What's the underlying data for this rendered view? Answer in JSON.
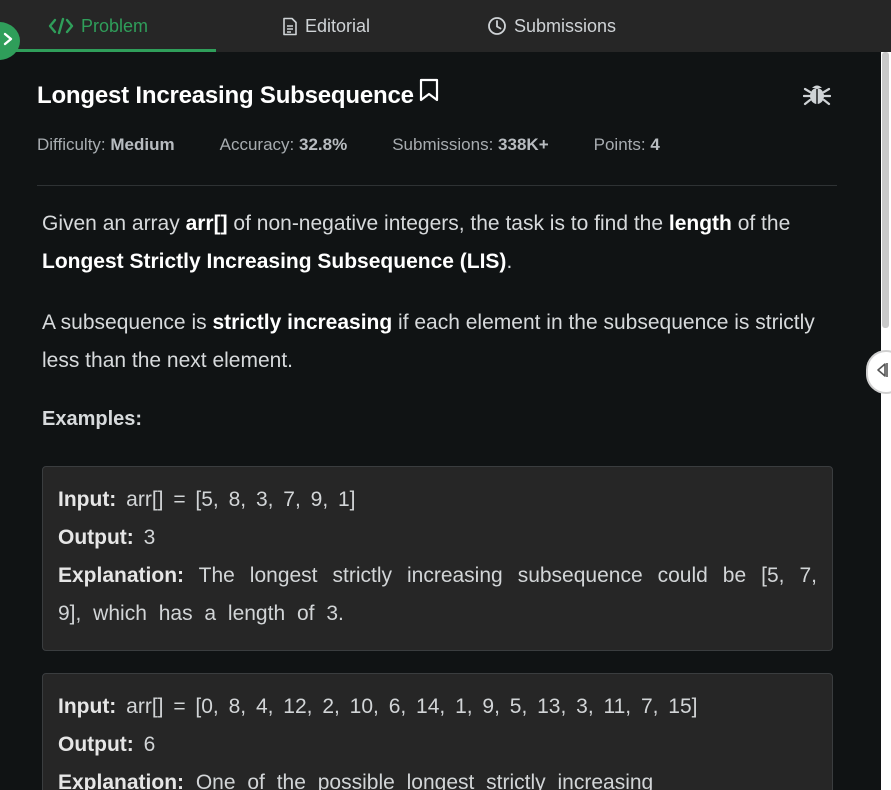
{
  "tabs": {
    "problem": "Problem",
    "editorial": "Editorial",
    "submissions": "Submissions"
  },
  "problem": {
    "title": "Longest Increasing Subsequence",
    "meta": {
      "difficulty_label": "Difficulty:",
      "difficulty": "Medium",
      "accuracy_label": "Accuracy:",
      "accuracy": "32.8%",
      "submissions_label": "Submissions:",
      "submissions": "338K+",
      "points_label": "Points:",
      "points": "4"
    },
    "description": {
      "p1_a": "Given an array ",
      "p1_b": "arr[]",
      "p1_c": " of non-negative integers, the task is to find the ",
      "p1_d": "length",
      "p1_e": " of the ",
      "p1_f": "Longest Strictly Increasing Subsequence (LIS)",
      "p1_g": ".",
      "p2_a": "A subsequence is ",
      "p2_b": "strictly increasing",
      "p2_c": " if each element in the subsequence is strictly less than the next element."
    },
    "examples_label": "Examples:",
    "examples": [
      {
        "input_label": "Input:",
        "input": " arr[] = [5, 8, 3, 7, 9, 1]",
        "output_label": "Output:",
        "output": " 3",
        "explanation_label": "Explanation:",
        "explanation": " The longest strictly increasing subsequence could be [5, 7, 9], which has a length of 3."
      },
      {
        "input_label": "Input:",
        "input": " arr[] = [0, 8, 4, 12, 2, 10, 6, 14, 1, 9, 5, 13, 3, 11, 7, 15]",
        "output_label": "Output:",
        "output": " 6",
        "explanation_label": "Explanation:",
        "explanation": " One of the possible longest strictly increasing"
      }
    ]
  },
  "colors": {
    "accent": "#2f9e5a",
    "background": "#101314",
    "tabbar": "#262626",
    "example_box": "#262626"
  },
  "icons": [
    "code-icon",
    "document-icon",
    "clock-icon",
    "bookmark-icon",
    "bug-icon",
    "chevron-right-icon",
    "caret-left-icon"
  ]
}
